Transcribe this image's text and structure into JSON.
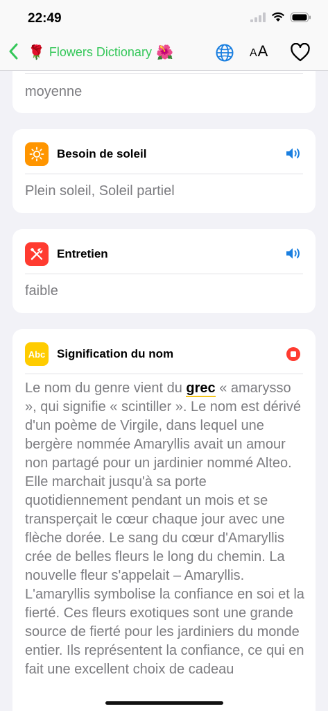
{
  "status": {
    "time": "22:49"
  },
  "nav": {
    "title": "Flowers Dictionary",
    "emoji_left": "🌹",
    "emoji_right": "🌺",
    "text_size_small": "A",
    "text_size_large": "A"
  },
  "cards": [
    {
      "value": "moyenne"
    },
    {
      "title": "Besoin de soleil",
      "value": "Plein soleil, Soleil partiel",
      "icon": "sun-icon",
      "color": "#ff9500"
    },
    {
      "title": "Entretien",
      "value": "faible",
      "icon": "tools-icon",
      "color": "#ff3b30"
    },
    {
      "title": "Signification du nom",
      "icon_text": "Abc",
      "icon": "abc-icon",
      "color": "#ffcc00",
      "body_before": "Le nom du genre vient du ",
      "body_highlight": "grec",
      "body_after": " « amarysso », qui signifie « scintiller ». Le nom est dérivé d'un poème de Virgile, dans lequel une bergère nommée Amaryllis avait un amour non partagé pour un jardinier nommé Alteo. Elle marchait jusqu'à sa porte quotidiennement pendant un mois et se transperçait le cœur chaque jour avec une flèche dorée. Le sang du cœur d'Amaryllis crée de belles fleurs le long du chemin. La nouvelle fleur s'appelait – Amaryllis. L'amaryllis symbolise la confiance en soi et la fierté. Ces fleurs exotiques sont une grande source de fierté pour les jardiniers du monde entier. Ils représentent la confiance, ce qui en fait une excellent choix de cadeau"
    }
  ],
  "colors": {
    "accent": "#34c759",
    "link_blue": "#1a7fe0",
    "stop_red": "#ff3b30"
  }
}
